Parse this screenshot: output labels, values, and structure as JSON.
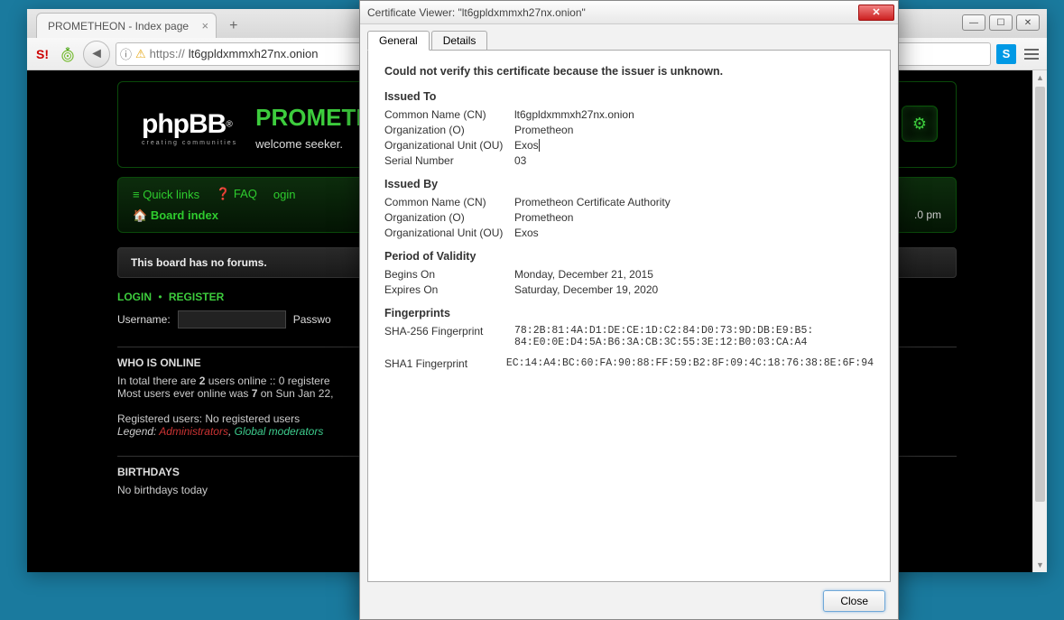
{
  "browser": {
    "tab_title": "PROMETHEON - Index page",
    "url_prefix": "https://",
    "url_domain": "lt6gpldxmmxh27nx.onion",
    "s_label": "S!",
    "sk_label": "S"
  },
  "forum": {
    "logo_main": "phpBB",
    "logo_sub": "creating communities",
    "title": "PROMETHEON",
    "welcome": "welcome seeker.",
    "nav": {
      "quicklinks": "Quick links",
      "faq": "FAQ",
      "login": "ogin",
      "board_index": "Board index",
      "time": ".0 pm"
    },
    "no_forums": "This board has no forums.",
    "login_title": "LOGIN",
    "register_title": "REGISTER",
    "username_label": "Username:",
    "password_label": "Passwo",
    "who_title": "WHO IS ONLINE",
    "who_line1_a": "In total there are ",
    "who_line1_b": "2",
    "who_line1_c": " users online :: 0 registere",
    "who_line2_a": "Most users ever online was ",
    "who_line2_b": "7",
    "who_line2_c": " on Sun Jan 22, ",
    "reg_users": "Registered users: No registered users",
    "legend_label": "Legend: ",
    "admins": "Administrators",
    "mods": "Global moderators",
    "birthdays_title": "BIRTHDAYS",
    "birthdays_text": "No birthdays today"
  },
  "cert": {
    "title": "Certificate Viewer: \"lt6gpldxmmxh27nx.onion\"",
    "tab_general": "General",
    "tab_details": "Details",
    "warning": "Could not verify this certificate because the issuer is unknown.",
    "issued_to_title": "Issued To",
    "issued_by_title": "Issued By",
    "validity_title": "Period of Validity",
    "fingerprints_title": "Fingerprints",
    "labels": {
      "cn": "Common Name (CN)",
      "o": "Organization (O)",
      "ou": "Organizational Unit (OU)",
      "serial": "Serial Number",
      "begins": "Begins On",
      "expires": "Expires On",
      "sha256": "SHA-256 Fingerprint",
      "sha1": "SHA1 Fingerprint"
    },
    "to": {
      "cn": "lt6gpldxmmxh27nx.onion",
      "o": "Prometheon",
      "ou": "Exos",
      "serial": "03"
    },
    "by": {
      "cn": "Prometheon Certificate Authority",
      "o": "Prometheon",
      "ou": "Exos"
    },
    "validity": {
      "begins": "Monday, December 21, 2015",
      "expires": "Saturday, December 19, 2020"
    },
    "fp": {
      "sha256_1": "78:2B:81:4A:D1:DE:CE:1D:C2:84:D0:73:9D:DB:E9:B5:",
      "sha256_2": "84:E0:0E:D4:5A:B6:3A:CB:3C:55:3E:12:B0:03:CA:A4",
      "sha1": "EC:14:A4:BC:60:FA:90:88:FF:59:B2:8F:09:4C:18:76:38:8E:6F:94"
    },
    "close_btn": "Close"
  }
}
